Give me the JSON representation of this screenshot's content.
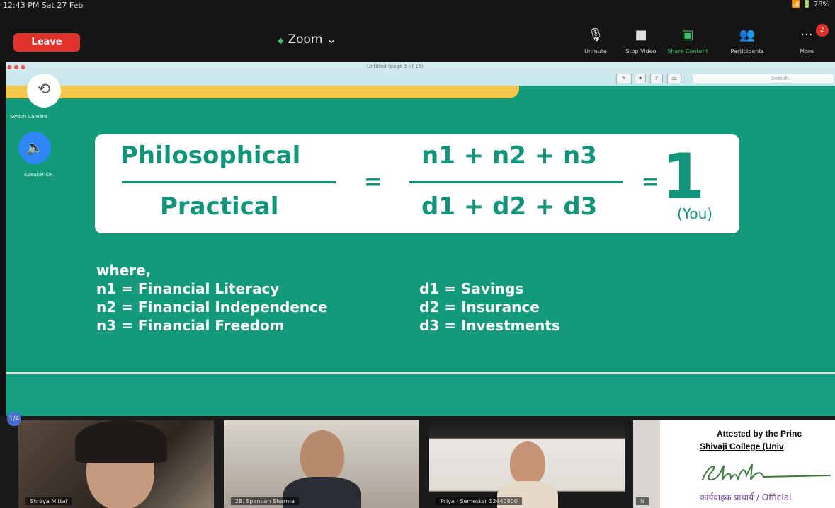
{
  "status_bar": {
    "time": "12:43 PM  Sat 27 Feb",
    "right": "78%"
  },
  "toolbar": {
    "leave_label": "Leave",
    "title": "Zoom",
    "title_chevron": "⌄",
    "items": [
      {
        "label": "Unmute",
        "icon": "microphone-muted-icon"
      },
      {
        "label": "Stop Video",
        "icon": "video-camera-icon"
      },
      {
        "label": "Share Content",
        "icon": "share-screen-icon"
      },
      {
        "label": "Participants",
        "icon": "participants-icon"
      },
      {
        "label": "More",
        "icon": "more-dots-icon"
      }
    ],
    "more_badge": "2"
  },
  "side_controls": {
    "camera_label": "Switch Camera",
    "speaker_label": "Speaker On"
  },
  "share": {
    "doc_title": "Untitled (page 3 of 15)",
    "search_placeholder": "Search",
    "formula": {
      "num1": "Philosophical",
      "den1": "Practical",
      "num2": "n1 + n2 + n3",
      "den2": "d1 + d2 + d3",
      "eq": "=",
      "result": "1",
      "result_note": "(You)"
    },
    "where_label": "where,",
    "definitions_left": [
      "n1 = Financial Literacy",
      "n2 = Financial Independence",
      "n3 = Financial Freedom"
    ],
    "definitions_right": [
      "d1 = Savings",
      "d2 = Insurance",
      "d3 = Investments"
    ]
  },
  "participants": [
    {
      "name": "Shreya Mittal"
    },
    {
      "name": "28. Spandan Sharma"
    },
    {
      "name": "Priya · Semester 12440800"
    },
    {
      "name": "N"
    }
  ],
  "page_indicator": "1/4",
  "stamp": {
    "line1": "Attested by the Princ",
    "line2": "Shivaji College (Univ",
    "signature": "Shivk",
    "line3": "कार्यवाहक प्राचार्य / Official"
  },
  "colors": {
    "slide_green": "#139a7b",
    "leave_red": "#e0312b",
    "speaker_blue": "#2f86f6"
  }
}
